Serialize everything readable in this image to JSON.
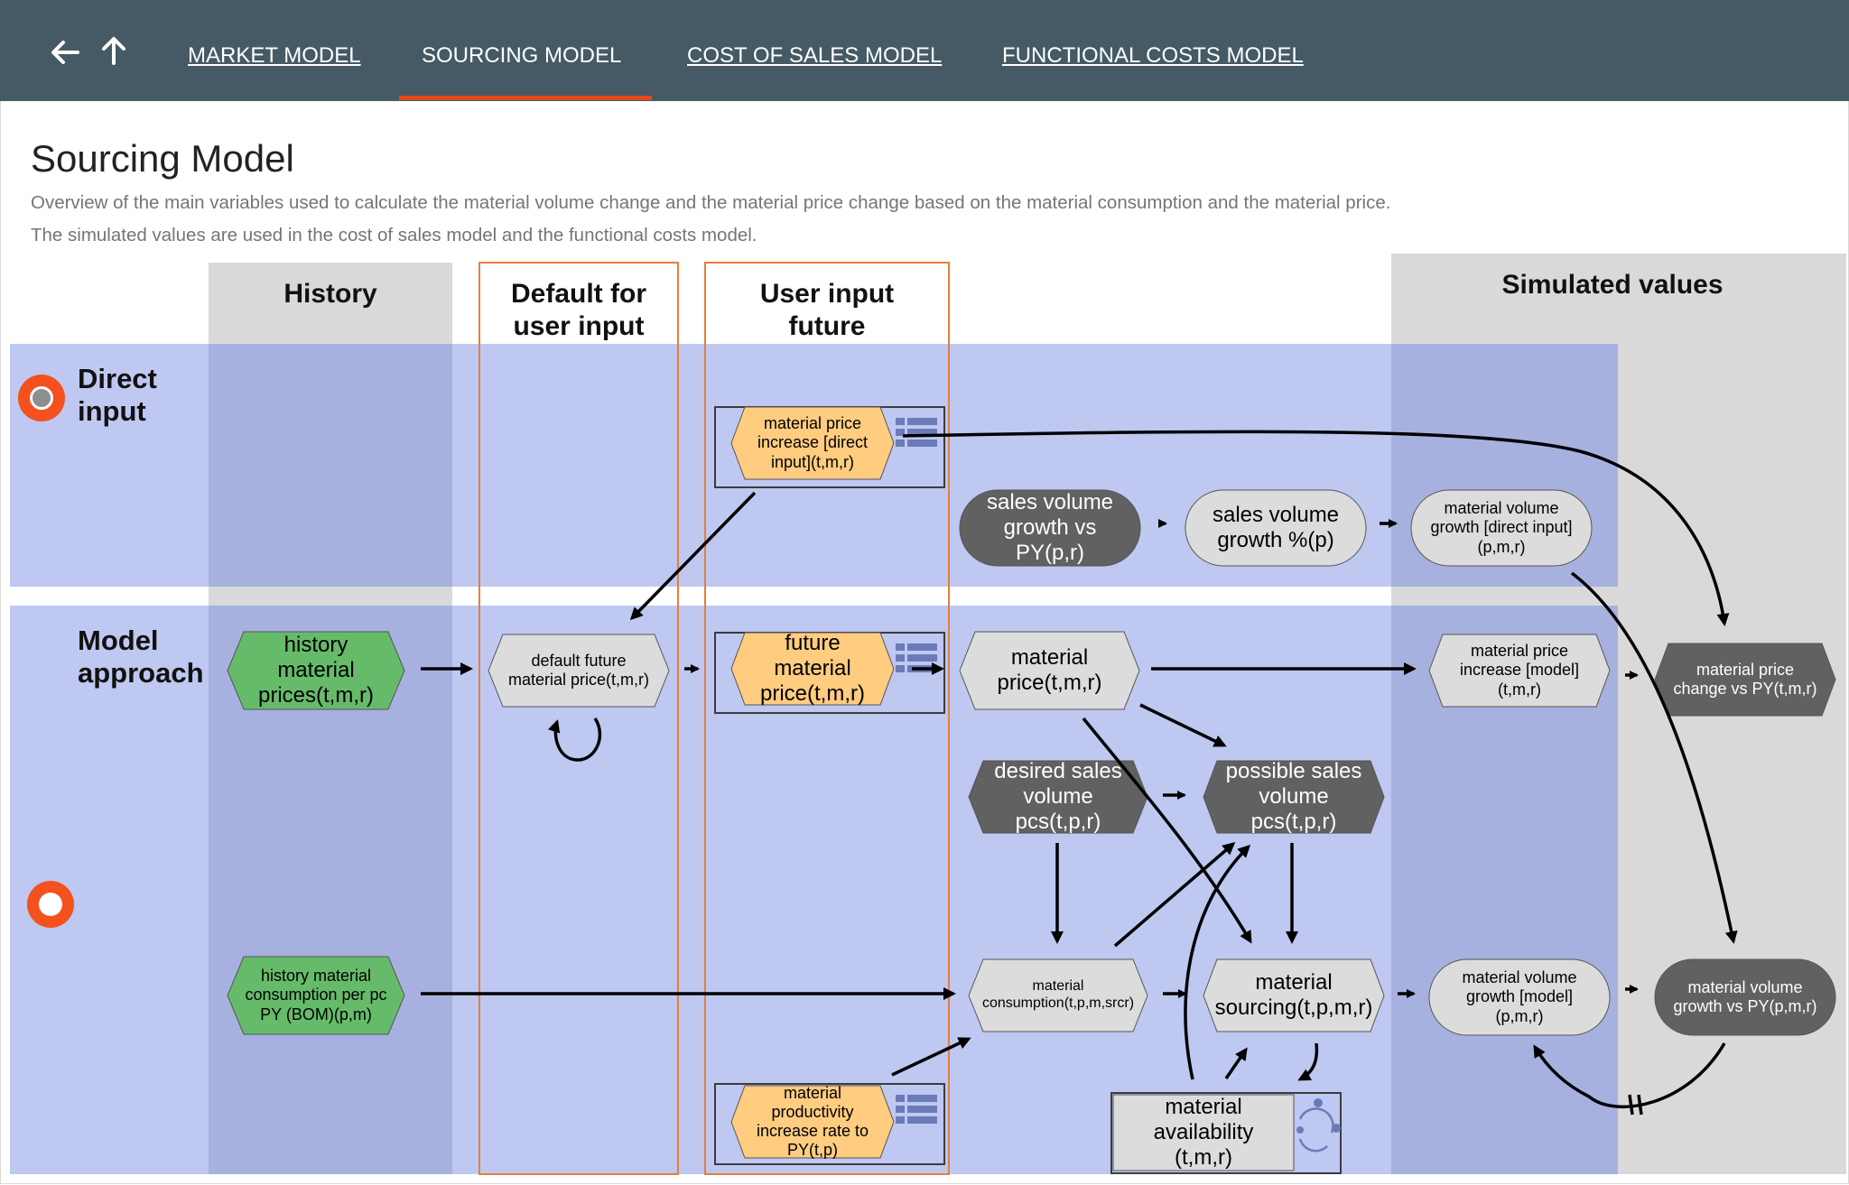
{
  "nav": {
    "back_icon": "arrow-left-icon",
    "up_icon": "arrow-up-icon",
    "tabs": [
      {
        "label": "MARKET MODEL",
        "active": false
      },
      {
        "label": "SOURCING MODEL",
        "active": true
      },
      {
        "label": "COST OF SALES MODEL",
        "active": false
      },
      {
        "label": "FUNCTIONAL COSTS MODEL",
        "active": false
      }
    ],
    "accent_color": "#e64a19",
    "bar_color": "#455a64"
  },
  "page": {
    "title": "Sourcing Model",
    "description_1": "Overview of the main variables used to calculate the material volume change and the material price change based on the material consumption and the material price.",
    "description_2": "The simulated values are used in the cost of sales model and the functional costs model."
  },
  "diagram": {
    "columns": {
      "history": "History",
      "default_l1": "Default for",
      "default_l2": "user input",
      "user_l1": "User input",
      "user_l2": "future",
      "simulated": "Simulated values"
    },
    "rows": {
      "direct_l1": "Direct",
      "direct_l2": "input",
      "model_l1": "Model",
      "model_l2": "approach"
    },
    "selected_row": "model",
    "nodes": {
      "mpi_direct": "material price increase [direct input](t,m,r)",
      "sales_vol_vs_py": "sales volume growth vs PY(p,r)",
      "sales_vol_pct": "sales volume growth %(p)",
      "mvg_direct": "material volume growth [direct input](p,m,r)",
      "hist_prices": "history material prices(t,m,r)",
      "default_future_price": "default future material price(t,m,r)",
      "future_price": "future material price(t,m,r)",
      "material_price": "material price(t,m,r)",
      "mpi_model": "material price increase [model](t,m,r)",
      "price_change": "material price change vs PY(t,m,r)",
      "desired_sales": "desired sales volume pcs(t,p,r)",
      "possible_sales": "possible sales volume pcs(t,p,r)",
      "hist_consumption": "history material consumption per pc PY (BOM)(p,m)",
      "consumption": "material consumption(t,p,m,srcr)",
      "sourcing": "material sourcing(t,p,m,r)",
      "mvg_model": "material volume growth [model](p,m,r)",
      "volume_growth_py": "material volume growth vs PY(p,m,r)",
      "productivity": "material productivity increase rate to PY(t,p)",
      "availability": "material availability (t,m,r)"
    },
    "icons": {
      "input_table": "table-icon",
      "cycle": "cycle-icon"
    },
    "colors": {
      "history_node": "#66bb6a",
      "input_node": "#ffcc80",
      "calc_node": "#dcdcdc",
      "dark_node": "#616161",
      "band": "#b8c3f0",
      "column_border": "#e67e3c"
    }
  }
}
